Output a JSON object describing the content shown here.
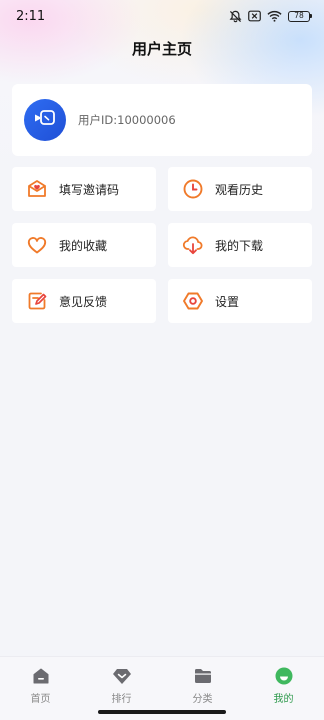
{
  "status_bar": {
    "time": "2:11",
    "battery": "78",
    "icons": [
      "bell-off-icon",
      "close-box-icon",
      "wifi-icon",
      "battery-icon"
    ]
  },
  "header": {
    "title": "用户主页"
  },
  "profile": {
    "avatar_icon": "video-call-icon",
    "user_id": "用户ID:10000006",
    "avatar_color": "#2f6df2"
  },
  "menu": [
    {
      "label": "填写邀请码",
      "icon": "invite-envelope-icon"
    },
    {
      "label": "观看历史",
      "icon": "clock-icon"
    },
    {
      "label": "我的收藏",
      "icon": "heart-icon"
    },
    {
      "label": "我的下载",
      "icon": "cloud-download-icon"
    },
    {
      "label": "意见反馈",
      "icon": "feedback-edit-icon"
    },
    {
      "label": "设置",
      "icon": "settings-hexagon-icon"
    }
  ],
  "accent_colors": {
    "icon_orange": "#f07a2a",
    "icon_red": "#e8453c",
    "active_tab": "#2e9a4c"
  },
  "tabs": [
    {
      "label": "首页",
      "icon": "home-icon",
      "active": false
    },
    {
      "label": "排行",
      "icon": "ranking-gem-icon",
      "active": false
    },
    {
      "label": "分类",
      "icon": "folder-icon",
      "active": false
    },
    {
      "label": "我的",
      "icon": "profile-smile-icon",
      "active": true
    }
  ]
}
